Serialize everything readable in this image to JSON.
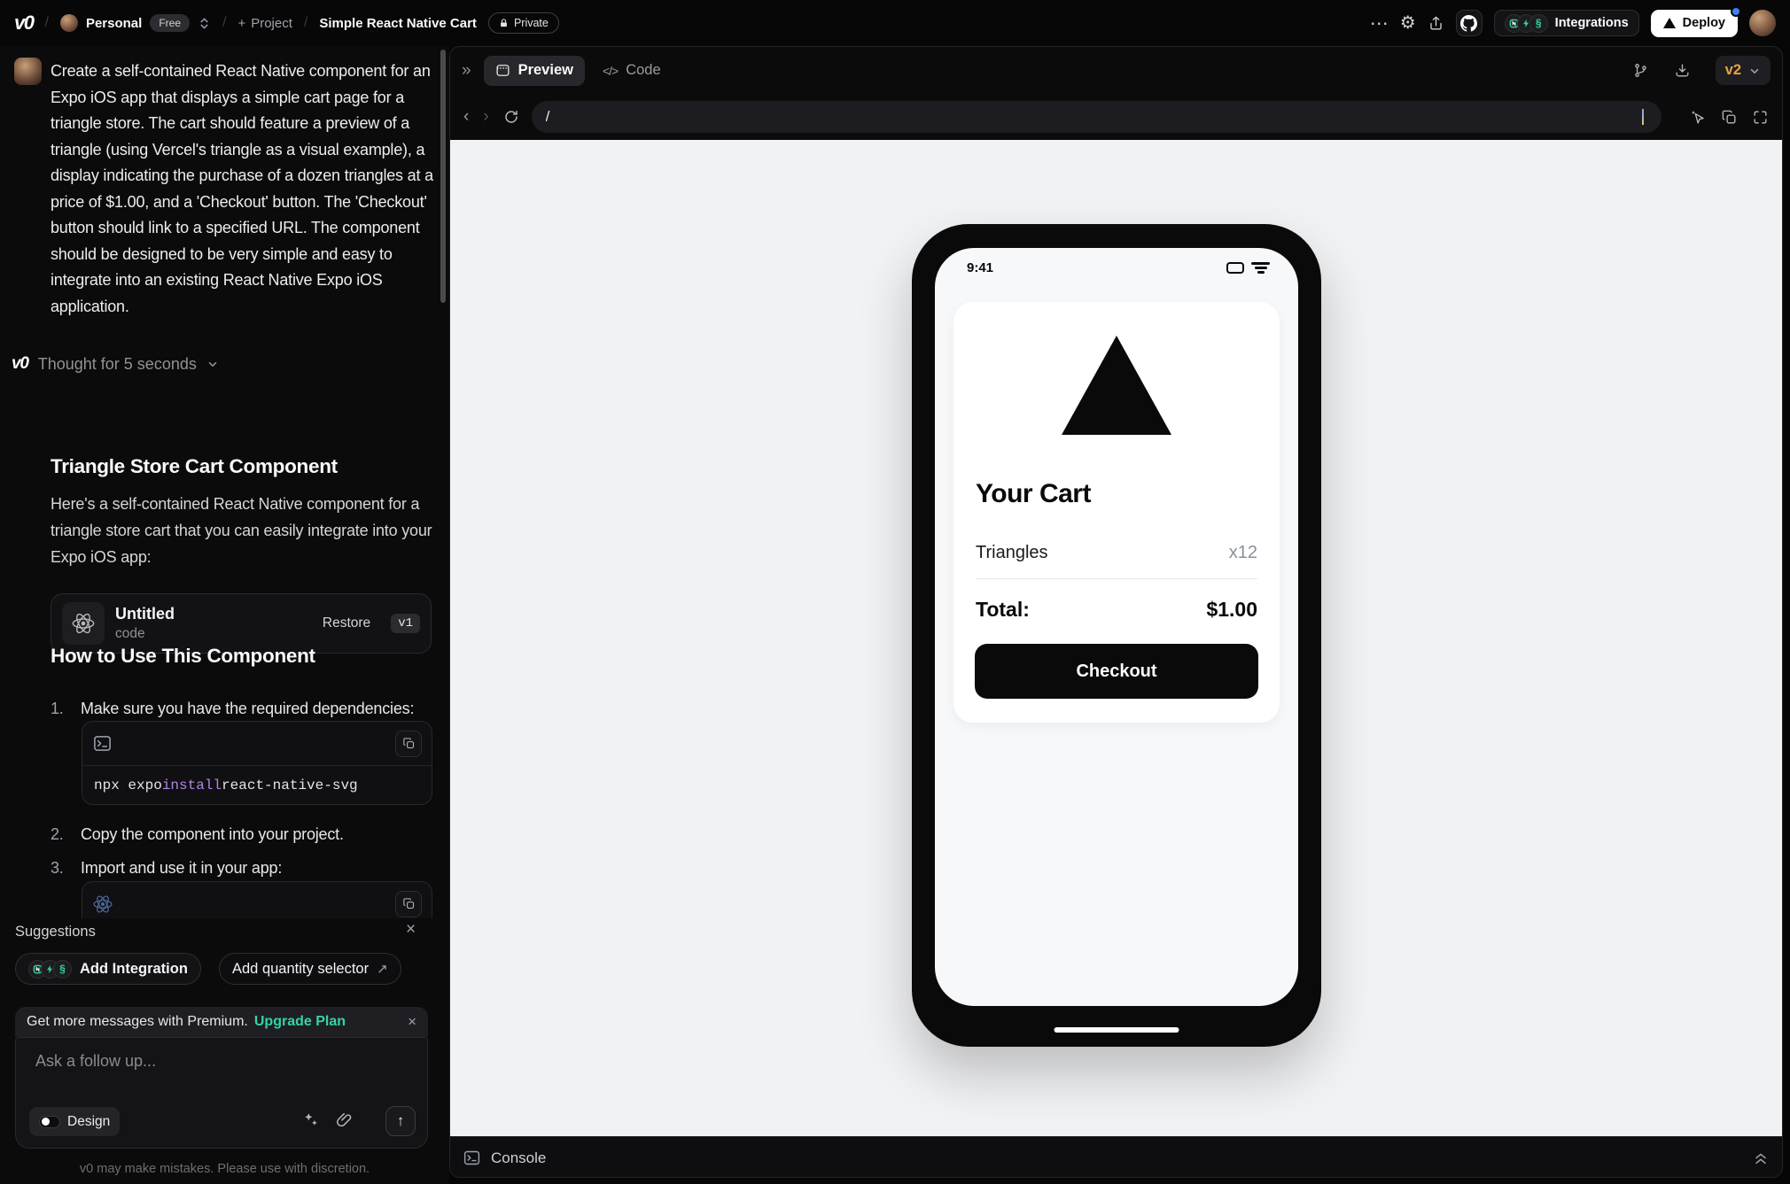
{
  "icons": {
    "ellipsis": "⋯",
    "gear": "⚙",
    "plus": "+",
    "slash": "/",
    "close": "×",
    "up_right_arrow": "↗",
    "send_arrow": "↑",
    "chevron_left": "‹",
    "chevron_right": "›",
    "expand": "»",
    "code_glyph": "</>",
    "spiral": "§"
  },
  "topbar": {
    "logo": "v0",
    "workspace": "Personal",
    "plan_badge": "Free",
    "new_project_label": "Project",
    "project_title": "Simple React Native Cart",
    "privacy_badge": "Private",
    "integrations_label": "Integrations",
    "deploy_label": "Deploy"
  },
  "chat": {
    "user_message": "Create a self-contained React Native component for an Expo iOS app that displays a simple cart page for a triangle store. The cart should feature a preview of a triangle (using Vercel's triangle as a visual example), a display indicating the purchase of a dozen triangles at a price of $1.00, and a 'Checkout' button. The 'Checkout' button should link to a specified URL. The component should be designed to be very simple and easy to integrate into an existing React Native Expo iOS application.",
    "thought_label": "Thought for 5 seconds",
    "response_heading": "Triangle Store Cart Component",
    "response_intro": "Here's a self-contained React Native component for a triangle store cart that you can easily integrate into your Expo iOS app:",
    "version_card": {
      "title": "Untitled",
      "subtitle": "code",
      "restore_label": "Restore",
      "version": "v1"
    },
    "howto_heading": "How to Use This Component",
    "steps": [
      {
        "num": "1.",
        "text": "Make sure you have the required dependencies:"
      },
      {
        "num": "2.",
        "text": "Copy the component into your project."
      },
      {
        "num": "3.",
        "text": "Import and use it in your app:"
      }
    ],
    "code_snippet": {
      "prefix": "npx expo ",
      "keyword": "install",
      "suffix": " react-native-svg"
    },
    "suggestions": {
      "label": "Suggestions",
      "add_integration_label": "Add Integration",
      "add_quantity_label": "Add quantity selector"
    },
    "premium_banner": {
      "text": "Get more messages with Premium.",
      "link_label": "Upgrade Plan"
    },
    "composer": {
      "placeholder": "Ask a follow up...",
      "design_label": "Design"
    },
    "disclaimer": "v0 may make mistakes. Please use with discretion."
  },
  "preview": {
    "tab_preview": "Preview",
    "tab_code": "Code",
    "url_value": "/",
    "version_selector": "v2",
    "console_label": "Console",
    "phone": {
      "status_time": "9:41",
      "cart_title": "Your Cart",
      "item_name": "Triangles",
      "item_qty": "x12",
      "total_label": "Total:",
      "total_value": "$1.00",
      "checkout_label": "Checkout"
    }
  },
  "colors": {
    "accent_teal": "#36d3a6",
    "version_orange": "#e8a33d",
    "notification_blue": "#3b82f6",
    "code_keyword_purple": "#b285e0"
  }
}
